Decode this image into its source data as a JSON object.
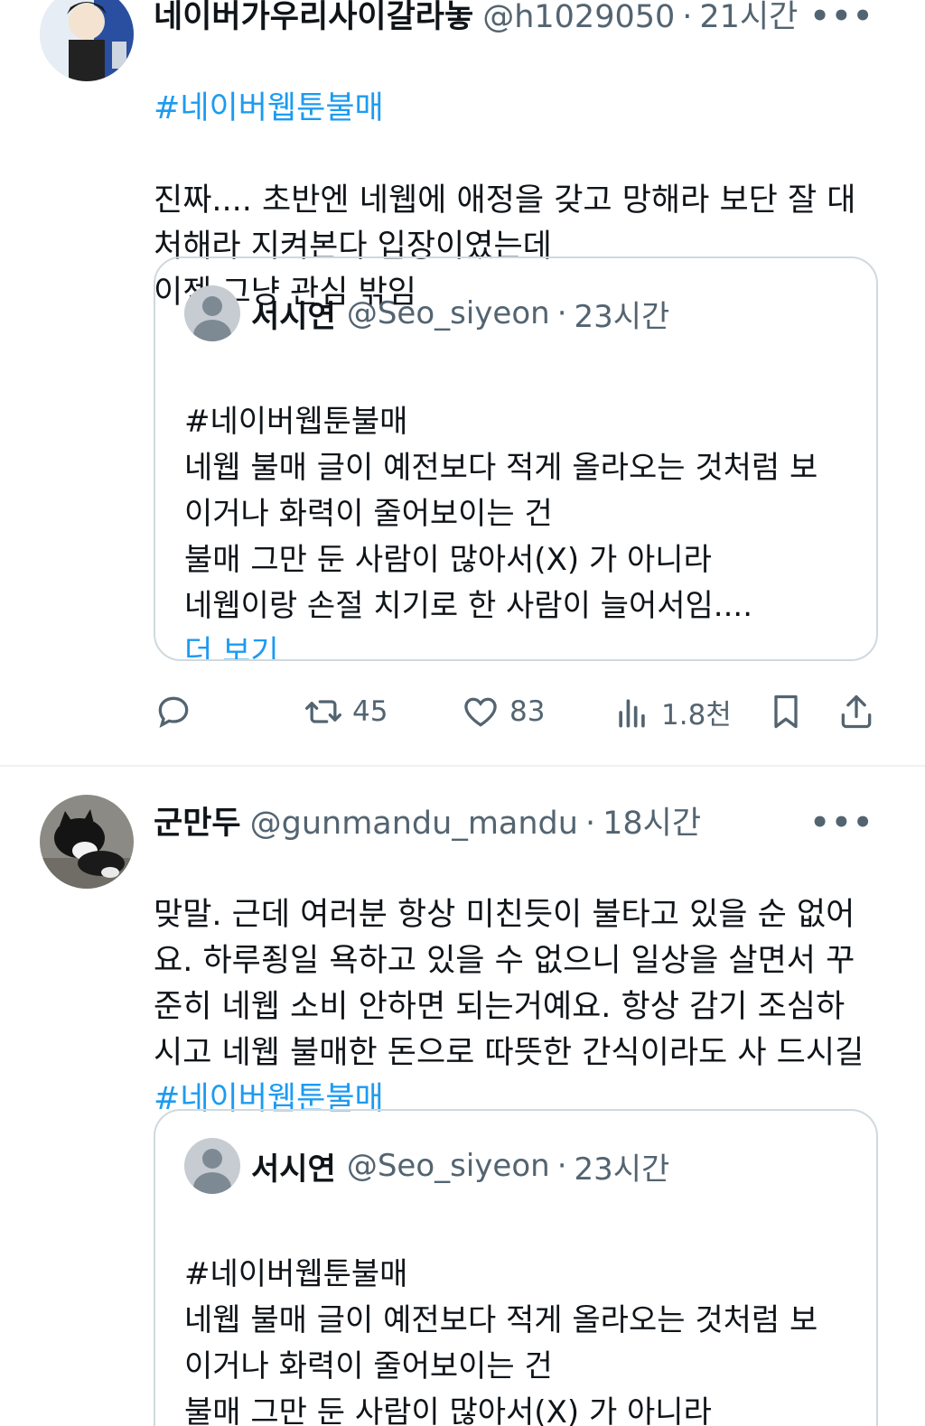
{
  "tweets": [
    {
      "author": "네이버가우리사이갈라놓",
      "handle": "@h1029050",
      "time": "21시간",
      "hashtag": "#네이버웹툰불매",
      "text": "진짜.... 초반엔 네웹에 애정을 갖고 망해라 보단 잘 대\n처해라 지켜본다 입장이였는데\n이젠 그냥 관심 밖임",
      "quote": {
        "author": "서시연",
        "handle": "@Seo_siyeon",
        "time": "23시간",
        "text": "#네이버웹툰불매\n네웹 불매 글이 예전보다 적게 올라오는 것처럼 보\n이거나 화력이 줄어보이는 건\n불매 그만 둔 사람이 많아서(X) 가 아니라\n네웹이랑 손절 치기로 한 사람이 늘어서임....",
        "show_more": "더 보기"
      },
      "actions": {
        "retweets": "45",
        "likes": "83",
        "views": "1.8천"
      }
    },
    {
      "author": "군만두",
      "handle": "@gunmandu_mandu",
      "time": "18시간",
      "text": "맞말. 근데 여러분 항상 미친듯이 불타고 있을 순 없어\n요. 하루죙일 욕하고 있을 수 없으니 일상을 살면서 꾸\n준히 네웹 소비 안하면 되는거예요. 항상 감기 조심하\n시고 네웹 불매한 돈으로 따뜻한 간식이라도 사 드시길",
      "hashtag": "#네이버웹툰불매",
      "quote": {
        "author": "서시연",
        "handle": "@Seo_siyeon",
        "time": "23시간",
        "text": "#네이버웹툰불매\n네웹 불매 글이 예전보다 적게 올라오는 것처럼 보\n이거나 화력이 줄어보이는 건\n불매 그만 둔 사람이 많아서(X) 가 아니라\n네웹이랑 손절 치기로 한 사람이 늘어서임"
      }
    }
  ],
  "colors": {
    "link": "#1d9bf0",
    "secondary": "#536471",
    "border": "#cfd9de"
  },
  "icons": [
    "reply-icon",
    "retweet-icon",
    "like-icon",
    "views-icon",
    "bookmark-icon",
    "share-icon",
    "more-icon"
  ]
}
